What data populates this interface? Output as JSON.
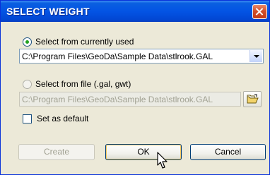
{
  "window": {
    "title": "SELECT WEIGHT"
  },
  "options": {
    "currently_used": {
      "label": "Select from currently used",
      "selected": true
    },
    "current_file": "C:\\Program Files\\GeoDa\\Sample Data\\stlrook.GAL",
    "from_file": {
      "label": "Select from file (.gal, gwt)",
      "selected": false
    },
    "file_path": "C:\\Program Files\\GeoDa\\Sample Data\\stlrook.GAL",
    "set_default": {
      "label": "Set as default",
      "checked": false
    }
  },
  "buttons": {
    "create": "Create",
    "ok": "OK",
    "cancel": "Cancel"
  }
}
